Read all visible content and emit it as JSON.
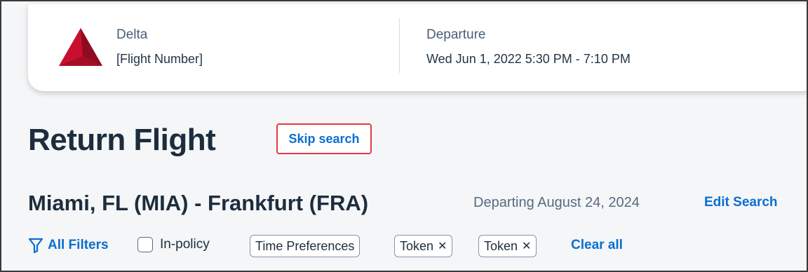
{
  "flight_card": {
    "airline": "Delta",
    "flight_number": "[Flight Number]",
    "departure_label": "Departure",
    "departure_time": "Wed Jun 1, 2022 5:30 PM - 7:10 PM",
    "logo_icon": "delta-triangle-icon"
  },
  "header": {
    "title": "Return Flight",
    "skip_search": "Skip search"
  },
  "route": {
    "text": "Miami, FL (MIA) - Frankfurt (FRA)",
    "departing": "Departing August 24, 2024",
    "edit_search": "Edit Search"
  },
  "filters": {
    "all_filters": "All Filters",
    "in_policy": "In-policy",
    "chips": [
      {
        "label": "Time Preferences",
        "removable": false
      },
      {
        "label": "Token",
        "removable": true
      },
      {
        "label": "Token",
        "removable": true
      }
    ],
    "remove_symbol": "✕",
    "clear_all": "Clear all"
  },
  "colors": {
    "accent": "#0a6ed1",
    "highlight_border": "#e43a43",
    "title": "#1d2d3e",
    "logo_red": "#c8102e"
  }
}
